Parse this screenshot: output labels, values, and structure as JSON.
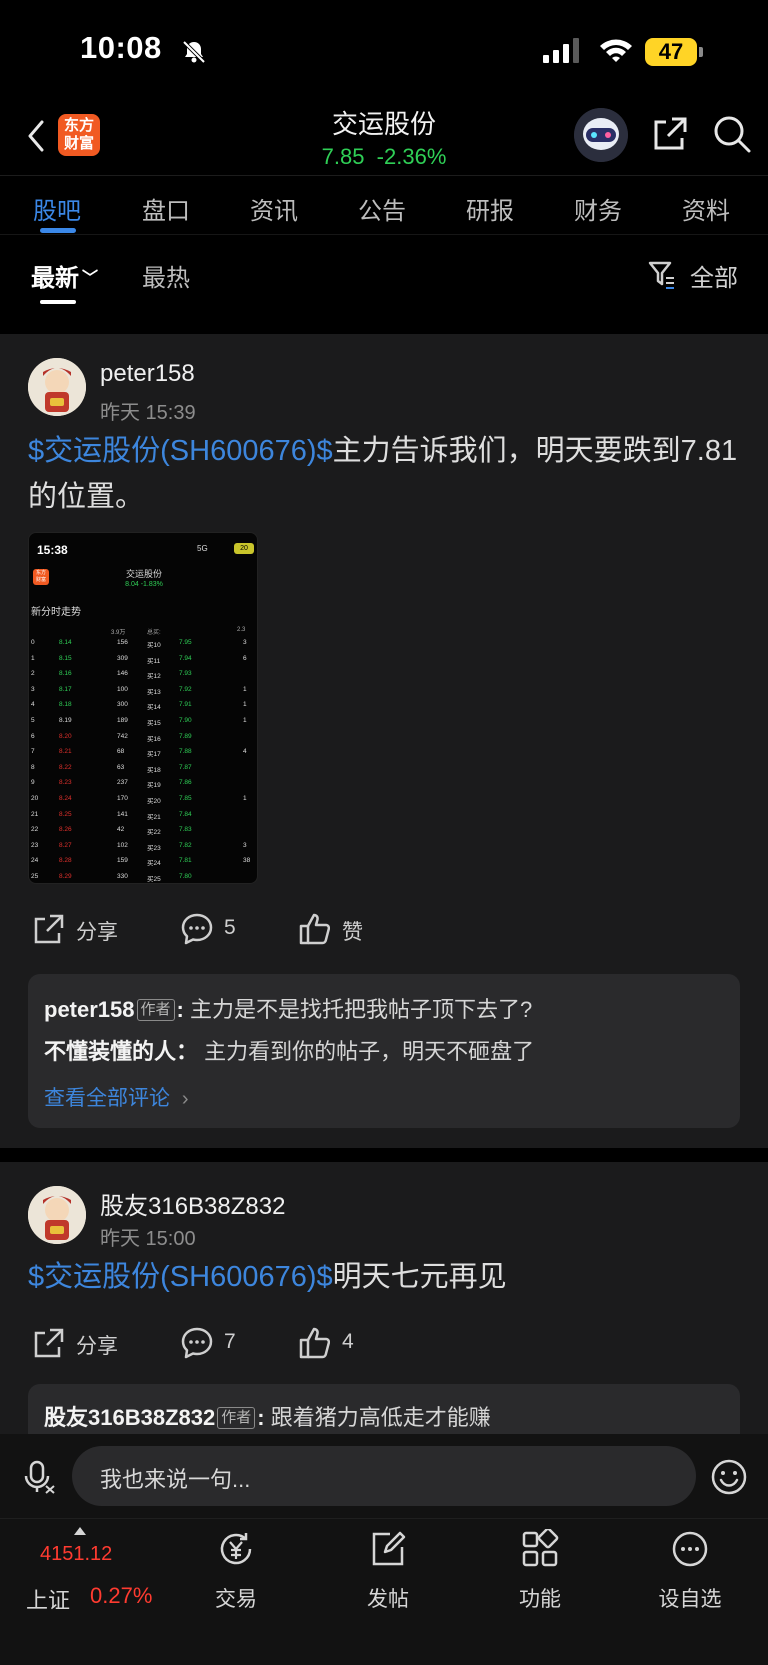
{
  "status_bar": {
    "time": "10:08",
    "battery": "47"
  },
  "header": {
    "app_logo": "东方\n财富",
    "stock_name": "交运股份",
    "price": "7.85",
    "change": "-2.36%",
    "price_color": "#2fcf56"
  },
  "tabs": [
    "股吧",
    "盘口",
    "资讯",
    "公告",
    "研报",
    "财务",
    "资料"
  ],
  "subtabs": {
    "latest": "最新",
    "hot": "最热",
    "filter": "全部"
  },
  "posts": [
    {
      "user": "peter158",
      "time": "昨天 15:39",
      "link": "$交运股份(SH600676)$",
      "text": "主力告诉我们，明天要跌到7.81的位置。",
      "actions": {
        "share": "分享",
        "comments": "5",
        "like": "赞"
      },
      "comments": [
        {
          "user": "peter158",
          "tag": "作者",
          "text": "主力是不是找托把我帖子顶下去了?"
        },
        {
          "user": "不懂装懂的人",
          "text": "主力看到你的帖子，明天不砸盘了"
        }
      ],
      "more": "查看全部评论",
      "image": {
        "time": "15:38",
        "network": "5G",
        "battery": "20",
        "logo": "东方\n财富",
        "title": "交运股份",
        "price": "8.04  -1.83%",
        "section": "新分时走势",
        "head": [
          "3.9万",
          "总买:",
          "2.3"
        ],
        "rows": [
          [
            "0",
            "8.14",
            "156",
            "买10",
            "7.95",
            "3"
          ],
          [
            "1",
            "8.15",
            "309",
            "买11",
            "7.94",
            "6"
          ],
          [
            "2",
            "8.16",
            "146",
            "买12",
            "7.93",
            ""
          ],
          [
            "3",
            "8.17",
            "100",
            "买13",
            "7.92",
            "1"
          ],
          [
            "4",
            "8.18",
            "300",
            "买14",
            "7.91",
            "1"
          ],
          [
            "5",
            "8.19",
            "189",
            "买15",
            "7.90",
            "1"
          ],
          [
            "6",
            "8.20",
            "742",
            "买16",
            "7.89",
            ""
          ],
          [
            "7",
            "8.21",
            "68",
            "买17",
            "7.88",
            "4"
          ],
          [
            "8",
            "8.22",
            "63",
            "买18",
            "7.87",
            ""
          ],
          [
            "9",
            "8.23",
            "237",
            "买19",
            "7.86",
            ""
          ],
          [
            "20",
            "8.24",
            "170",
            "买20",
            "7.85",
            "1"
          ],
          [
            "21",
            "8.25",
            "141",
            "买21",
            "7.84",
            ""
          ],
          [
            "22",
            "8.26",
            "42",
            "买22",
            "7.83",
            ""
          ],
          [
            "23",
            "8.27",
            "102",
            "买23",
            "7.82",
            "3"
          ],
          [
            "24",
            "8.28",
            "159",
            "买24",
            "7.81",
            "38"
          ],
          [
            "25",
            "8.29",
            "330",
            "买25",
            "7.80",
            ""
          ]
        ]
      }
    },
    {
      "user": "股友316B38Z832",
      "time": "昨天 15:00",
      "link": "$交运股份(SH600676)$",
      "text": "明天七元再见",
      "actions": {
        "share": "分享",
        "comments": "7",
        "like": "4"
      },
      "comments": [
        {
          "user": "股友316B38Z832",
          "tag": "作者",
          "text": "跟着猪力高低走才能赚"
        }
      ]
    }
  ],
  "input": {
    "placeholder": "我也来说一句..."
  },
  "bottom_nav": {
    "index_value": "4151.12",
    "index_name": "上证",
    "index_change": "0.27%",
    "items": [
      "交易",
      "发帖",
      "功能",
      "设自选"
    ]
  }
}
